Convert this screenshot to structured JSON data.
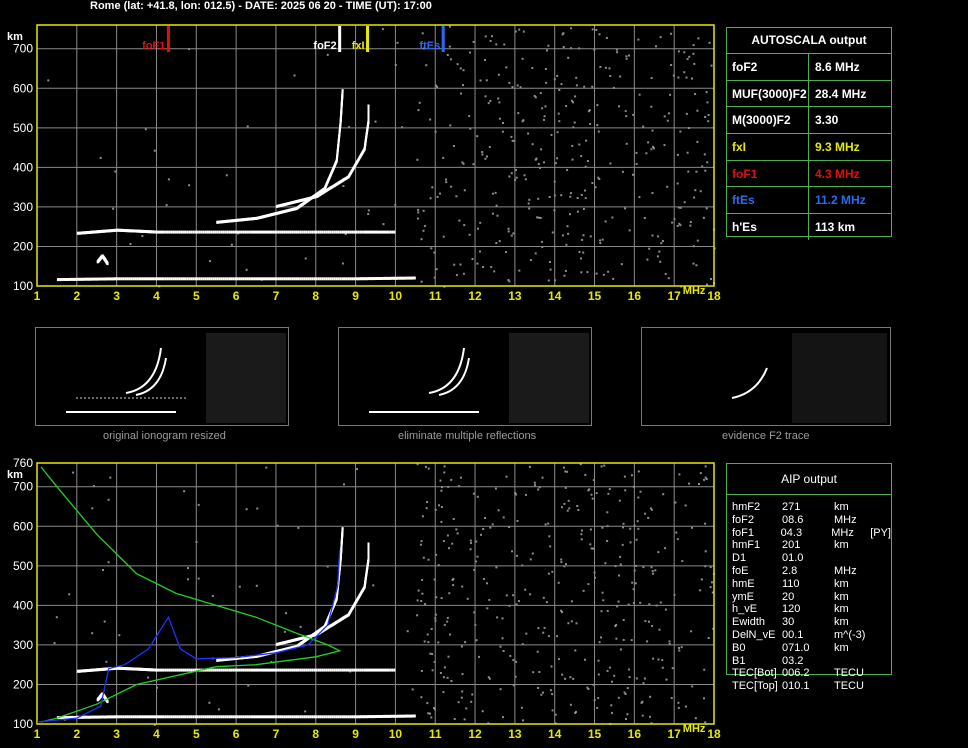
{
  "header": "Rome (lat: +41.8, lon: 012.5) - DATE: 2025 06 20 - TIME (UT): 17:00",
  "colors": {
    "grid": "#8a8a8a",
    "axis": "#e8e800",
    "foF1": "#e01010",
    "foF2": "#ffffff",
    "fxI": "#e8e800",
    "ftEs": "#2a6cf0",
    "green": "#22d022",
    "blue": "#2030ff",
    "border": "#4caf50"
  },
  "axes": {
    "x_ticks": [
      "1",
      "2",
      "3",
      "4",
      "5",
      "6",
      "7",
      "8",
      "9",
      "10",
      "11",
      "12",
      "13",
      "14",
      "15",
      "16",
      "17",
      "18"
    ],
    "x_unit": "MHz",
    "y_ticks": [
      "700",
      "600",
      "500",
      "400",
      "300",
      "200",
      "100"
    ],
    "y_ticks_lower": [
      "760",
      "700",
      "600",
      "500",
      "400",
      "300",
      "200",
      "100"
    ],
    "y_unit": "km"
  },
  "markers": [
    {
      "label": "foF1",
      "freq": 4.3,
      "color": "#e01010"
    },
    {
      "label": "foF2",
      "freq": 8.6,
      "color": "#ffffff"
    },
    {
      "label": "fxI",
      "freq": 9.3,
      "color": "#e8e800"
    },
    {
      "label": "ftEs",
      "freq": 11.2,
      "color": "#2a6cf0"
    }
  ],
  "autoscala": {
    "title": "AUTOSCALA output",
    "rows": [
      {
        "key": "foF2",
        "value": "8.6 MHz",
        "color": "#ffffff"
      },
      {
        "key": "MUF(3000)F2",
        "value": "28.4 MHz",
        "color": "#ffffff"
      },
      {
        "key": "M(3000)F2",
        "value": "3.30",
        "color": "#ffffff"
      },
      {
        "key": "fxI",
        "value": "9.3 MHz",
        "color": "#e8e800"
      },
      {
        "key": "foF1",
        "value": "4.3 MHz",
        "color": "#e01010"
      },
      {
        "key": "ftEs",
        "value": "11.2 MHz",
        "color": "#2a6cf0"
      },
      {
        "key": "h'Es",
        "value": "113    km",
        "color": "#ffffff"
      }
    ]
  },
  "aip": {
    "title": "AIP output",
    "rows": [
      [
        "hmF2",
        "271",
        "km",
        ""
      ],
      [
        "foF2",
        "08.6",
        "MHz",
        ""
      ],
      [
        "foF1",
        "04.3",
        "MHz",
        "[PY]"
      ],
      [
        "hmF1",
        "201",
        "km",
        ""
      ],
      [
        "D1",
        "01.0",
        "",
        ""
      ],
      [
        "foE",
        "2.8",
        "MHz",
        ""
      ],
      [
        "hmE",
        "110",
        "km",
        ""
      ],
      [
        "ymE",
        "20",
        "km",
        ""
      ],
      [
        "h_vE",
        "120",
        "km",
        ""
      ],
      [
        "Ewidth",
        "30",
        "km",
        ""
      ],
      [
        "DelN_vE",
        "00.1",
        "m^(-3)",
        ""
      ],
      [
        "B0",
        "071.0",
        "km",
        ""
      ],
      [
        "B1",
        "03.2",
        "",
        ""
      ],
      [
        "TEC[Bot]",
        "006.2",
        "TECU",
        ""
      ],
      [
        "TEC[Top]",
        "010.1",
        "TECU",
        ""
      ]
    ]
  },
  "captions": [
    "original ionogram resized",
    "eliminate multiple reflections",
    "evidence F2 trace"
  ],
  "chart_data": [
    {
      "type": "scatter",
      "title": "",
      "xlabel": "MHz",
      "ylabel": "km",
      "xlim": [
        1,
        18
      ],
      "ylim": [
        100,
        760
      ],
      "grid": true,
      "series": [
        {
          "name": "",
          "values": [
            [
              1.5,
              120
            ],
            [
              3,
              122
            ],
            [
              5,
              122
            ],
            [
              7,
              122
            ],
            [
              9,
              122
            ],
            [
              10.5,
              124
            ]
          ]
        },
        {
          "name": "",
          "values": [
            [
              2.5,
              165
            ],
            [
              2.62,
              180
            ],
            [
              2.75,
              160
            ]
          ]
        },
        {
          "name": "",
          "values": [
            [
              2,
              237
            ],
            [
              3,
              245
            ],
            [
              4,
              240
            ],
            [
              6,
              240
            ],
            [
              8,
              240
            ],
            [
              10,
              240
            ]
          ]
        },
        {
          "name": "",
          "values": [
            [
              5.5,
              265
            ],
            [
              6.5,
              275
            ],
            [
              7.5,
              300
            ],
            [
              8.2,
              350
            ],
            [
              8.5,
              420
            ],
            [
              8.6,
              520
            ],
            [
              8.65,
              600
            ]
          ]
        },
        {
          "name": "",
          "values": [
            [
              7,
              305
            ],
            [
              8,
              330
            ],
            [
              8.8,
              380
            ],
            [
              9.2,
              450
            ],
            [
              9.3,
              520
            ],
            [
              9.3,
              560
            ]
          ]
        }
      ]
    },
    {
      "type": "line",
      "title": "",
      "xlabel": "MHz",
      "ylabel": "km",
      "xlim": [
        1,
        18
      ],
      "ylim": [
        100,
        760
      ],
      "grid": true,
      "series": [
        {
          "name": "",
          "values": [
            [
              1.1,
              750
            ],
            [
              1.5,
              700
            ],
            [
              2.5,
              580
            ],
            [
              3.5,
              480
            ],
            [
              4.5,
              430
            ],
            [
              5.5,
              400
            ],
            [
              6.5,
              370
            ],
            [
              7.5,
              330
            ],
            [
              8.3,
              300
            ],
            [
              8.6,
              285
            ],
            [
              8,
              270
            ],
            [
              6.5,
              250
            ],
            [
              5.5,
              245
            ],
            [
              3.5,
              200
            ],
            [
              2.5,
              150
            ],
            [
              1.5,
              115
            ],
            [
              1.1,
              105
            ]
          ]
        },
        {
          "name": "",
          "values": [
            [
              1,
              105
            ],
            [
              2,
              115
            ],
            [
              2.6,
              145
            ],
            [
              2.8,
              240
            ],
            [
              3.2,
              250
            ],
            [
              3.8,
              290
            ],
            [
              4.3,
              370
            ],
            [
              4.6,
              290
            ],
            [
              5,
              265
            ],
            [
              6,
              268
            ],
            [
              7,
              280
            ],
            [
              7.8,
              300
            ],
            [
              8.3,
              350
            ],
            [
              8.55,
              450
            ],
            [
              8.6,
              540
            ]
          ]
        }
      ]
    }
  ]
}
